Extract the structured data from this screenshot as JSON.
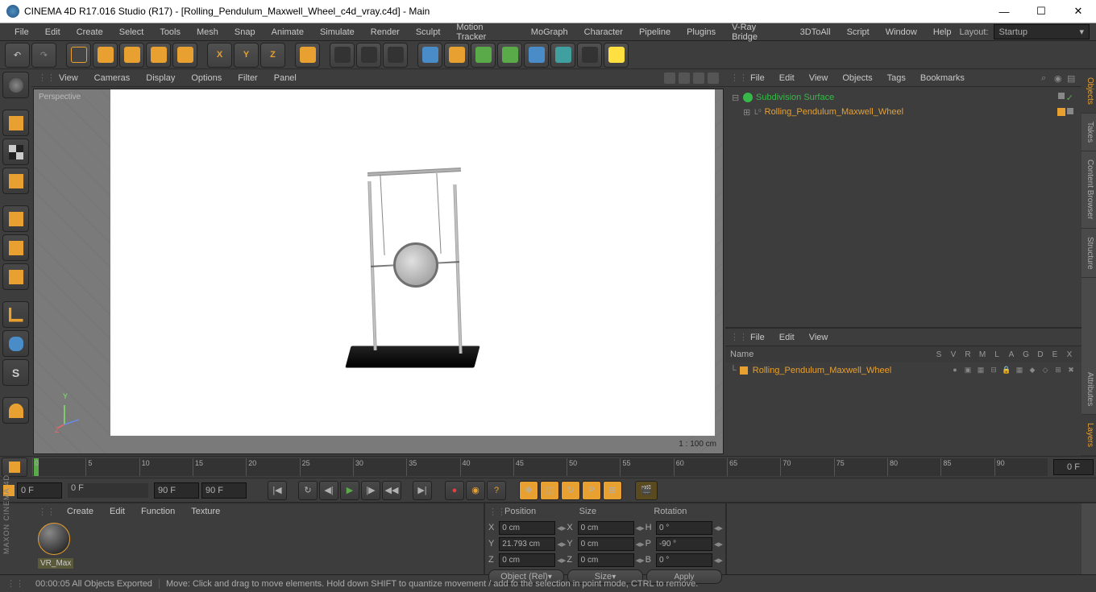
{
  "titlebar": {
    "title": "CINEMA 4D R17.016 Studio (R17) - [Rolling_Pendulum_Maxwell_Wheel_c4d_vray.c4d] - Main"
  },
  "menubar": {
    "items": [
      "File",
      "Edit",
      "Create",
      "Select",
      "Tools",
      "Mesh",
      "Snap",
      "Animate",
      "Simulate",
      "Render",
      "Sculpt",
      "Motion Tracker",
      "MoGraph",
      "Character",
      "Pipeline",
      "Plugins",
      "V-Ray Bridge",
      "3DToAll",
      "Script",
      "Window",
      "Help"
    ],
    "layout_label": "Layout:",
    "layout_value": "Startup"
  },
  "viewport_menu": {
    "items": [
      "View",
      "Cameras",
      "Display",
      "Options",
      "Filter",
      "Panel"
    ]
  },
  "viewport": {
    "label": "Perspective",
    "scale": "1 : 100 cm",
    "axis_y": "Y",
    "axis_z": "Z"
  },
  "objects_panel": {
    "menu": [
      "File",
      "Edit",
      "View",
      "Objects",
      "Tags",
      "Bookmarks"
    ],
    "tree": {
      "subdivision": "Subdivision Surface",
      "object": "Rolling_Pendulum_Maxwell_Wheel"
    }
  },
  "attr_panel": {
    "menu": [
      "File",
      "Edit",
      "View"
    ],
    "head_name": "Name",
    "cols": [
      "S",
      "V",
      "R",
      "M",
      "L",
      "A",
      "G",
      "D",
      "E",
      "X"
    ],
    "row_name": "Rolling_Pendulum_Maxwell_Wheel"
  },
  "right_tabs": [
    "Objects",
    "Takes",
    "Content Browser",
    "Structure",
    "Attributes",
    "Layers"
  ],
  "timeline": {
    "ticks": [
      "0",
      "5",
      "10",
      "15",
      "20",
      "25",
      "30",
      "35",
      "40",
      "45",
      "50",
      "55",
      "60",
      "65",
      "70",
      "75",
      "80",
      "85",
      "90"
    ],
    "end_field": "0 F"
  },
  "playback": {
    "start": "0 F",
    "current": "0 F",
    "end": "90 F",
    "end2": "90 F"
  },
  "material_panel": {
    "menu": [
      "Create",
      "Edit",
      "Function",
      "Texture"
    ],
    "mat_name": "VR_Max"
  },
  "coord": {
    "headers": [
      "Position",
      "Size",
      "Rotation"
    ],
    "rows": [
      {
        "axis": "X",
        "pos": "0 cm",
        "size_axis": "X",
        "size": "0 cm",
        "rot_axis": "H",
        "rot": "0 °"
      },
      {
        "axis": "Y",
        "pos": "21.793 cm",
        "size_axis": "Y",
        "size": "0 cm",
        "rot_axis": "P",
        "rot": "-90 °"
      },
      {
        "axis": "Z",
        "pos": "0 cm",
        "size_axis": "Z",
        "size": "0 cm",
        "rot_axis": "B",
        "rot": "0 °"
      }
    ],
    "obj_btn": "Object (Rel)",
    "size_btn": "Size",
    "apply_btn": "Apply"
  },
  "statusbar": {
    "time": "00:00:05 All Objects Exported",
    "hint": "Move: Click and drag to move elements. Hold down SHIFT to quantize movement / add to the selection in point mode, CTRL to remove."
  },
  "brand": "MAXON CINEMA 4D"
}
